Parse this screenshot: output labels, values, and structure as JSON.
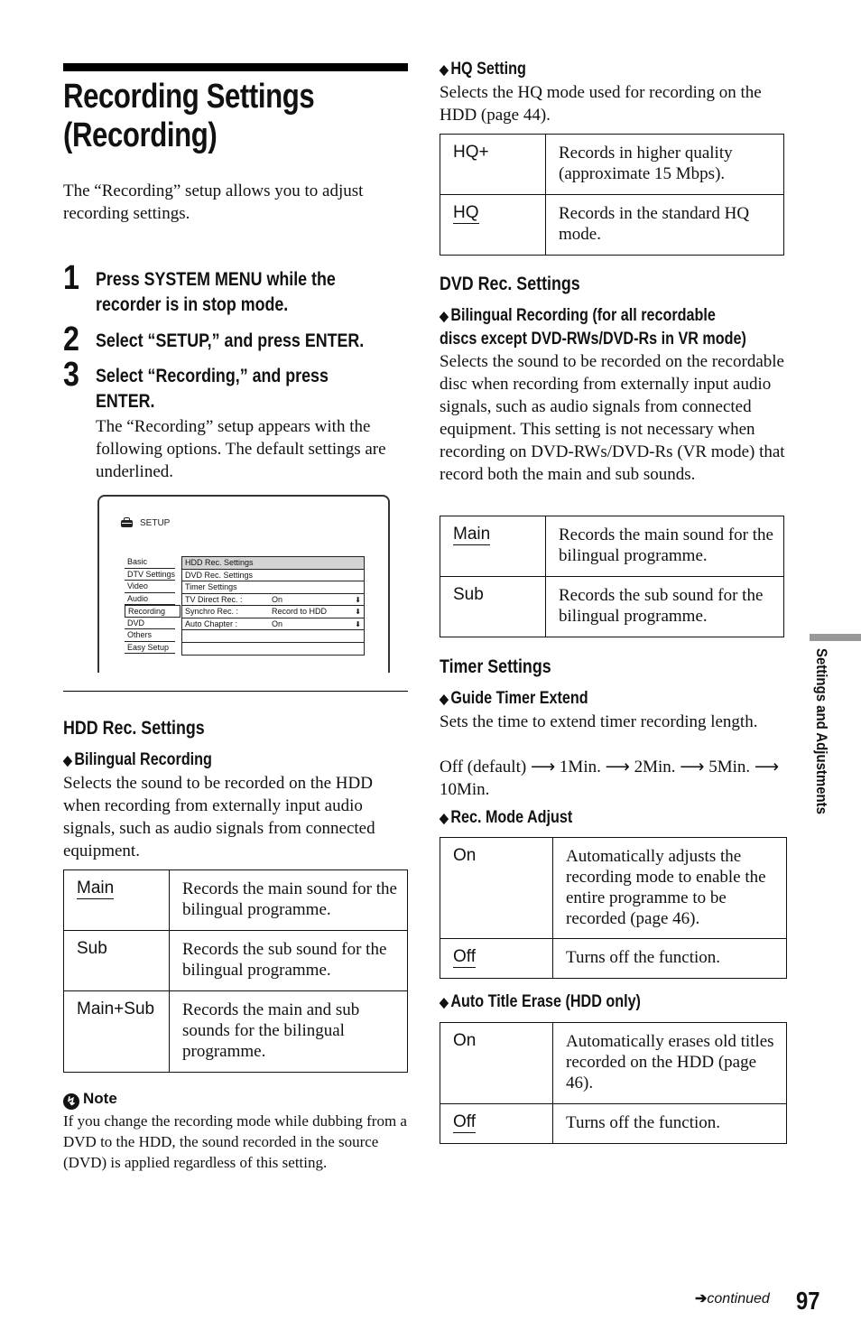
{
  "page": {
    "title_line1": "Recording Settings",
    "title_line2": "(Recording)",
    "intro": "The “Recording” setup allows you to adjust recording settings.",
    "side_tab": "Settings and Adjustments",
    "footer_continued": "continued",
    "page_number": "97"
  },
  "steps": [
    {
      "num": "1",
      "line1": "Press SYSTEM MENU while the",
      "line2": "recorder is in stop mode."
    },
    {
      "num": "2",
      "line1": "Select “SETUP,” and press ENTER.",
      "line2": ""
    },
    {
      "num": "3",
      "line1": "Select “Recording,” and press",
      "line2": "ENTER.",
      "body": "The “Recording” setup appears with the following options. The default settings are underlined."
    }
  ],
  "setup_screen": {
    "header": "SETUP",
    "left_menu": [
      "Basic",
      "DTV Settings",
      "Video",
      "Audio",
      "Recording",
      "DVD",
      "Others",
      "Easy Setup"
    ],
    "active_left": "Recording",
    "right_menu": [
      {
        "label": "HDD Rec. Settings",
        "value": "",
        "selected": true
      },
      {
        "label": "DVD Rec. Settings",
        "value": ""
      },
      {
        "label": "Timer Settings",
        "value": ""
      },
      {
        "label": "TV Direct Rec. :",
        "value": "On",
        "arrow": true
      },
      {
        "label": "Synchro Rec. :",
        "value": "Record to HDD",
        "arrow": true
      },
      {
        "label": "Auto Chapter :",
        "value": "On",
        "arrow": true
      },
      {
        "label": "",
        "value": ""
      },
      {
        "label": "",
        "value": ""
      }
    ]
  },
  "hdd": {
    "heading": "HDD Rec. Settings",
    "bilingual": {
      "title": "Bilingual Recording",
      "desc": "Selects the sound to be recorded on the HDD when recording from externally input audio signals, such as audio signals from connected equipment.",
      "options": [
        {
          "key": "Main",
          "default": true,
          "desc": "Records the main sound for the bilingual programme."
        },
        {
          "key": "Sub",
          "default": false,
          "desc": "Records the sub sound for the bilingual programme."
        },
        {
          "key": "Main+Sub",
          "default": false,
          "desc": "Records the main and sub sounds for the bilingual programme."
        }
      ]
    },
    "note": {
      "title": "Note",
      "body": "If you change the recording mode while dubbing from a DVD to the HDD, the sound recorded in the source (DVD) is applied regardless of this setting."
    },
    "hq": {
      "title": "HQ Setting",
      "desc": "Selects the HQ mode used for recording on the HDD (page 44).",
      "options": [
        {
          "key": "HQ+",
          "default": false,
          "desc": "Records in higher quality (approximate 15 Mbps)."
        },
        {
          "key": "HQ",
          "default": true,
          "desc": "Records in the standard HQ mode."
        }
      ]
    }
  },
  "dvd": {
    "heading": "DVD Rec. Settings",
    "bilingual": {
      "title_line1": "Bilingual Recording (for all recordable",
      "title_line2": "discs except DVD-RWs/DVD-Rs in VR mode)",
      "desc": "Selects the sound to be recorded on the recordable disc when recording from externally input audio signals, such as audio signals from connected equipment. This setting is not necessary when recording on DVD-RWs/DVD-Rs (VR mode) that record both the main and sub sounds.",
      "options": [
        {
          "key": "Main",
          "default": true,
          "desc": "Records the main sound for the bilingual programme."
        },
        {
          "key": "Sub",
          "default": false,
          "desc": "Records the sub sound for the bilingual programme."
        }
      ]
    }
  },
  "timer": {
    "heading": "Timer Settings",
    "guide_extend": {
      "title": "Guide Timer Extend",
      "desc": "Sets the time to extend timer recording length.",
      "sequence": "Off (default) ⟶ 1Min. ⟶ 2Min. ⟶ 5Min. ⟶ 10Min."
    },
    "rec_mode_adjust": {
      "title": "Rec. Mode Adjust",
      "options": [
        {
          "key": "On",
          "default": false,
          "desc": "Automatically adjusts the recording mode to enable the entire programme to be recorded (page 46)."
        },
        {
          "key": "Off",
          "default": true,
          "desc": "Turns off the function."
        }
      ]
    },
    "auto_title_erase": {
      "title": "Auto Title Erase (HDD only)",
      "options": [
        {
          "key": "On",
          "default": false,
          "desc": "Automatically erases old titles recorded on the HDD (page 46)."
        },
        {
          "key": "Off",
          "default": true,
          "desc": "Turns off the function."
        }
      ]
    }
  }
}
